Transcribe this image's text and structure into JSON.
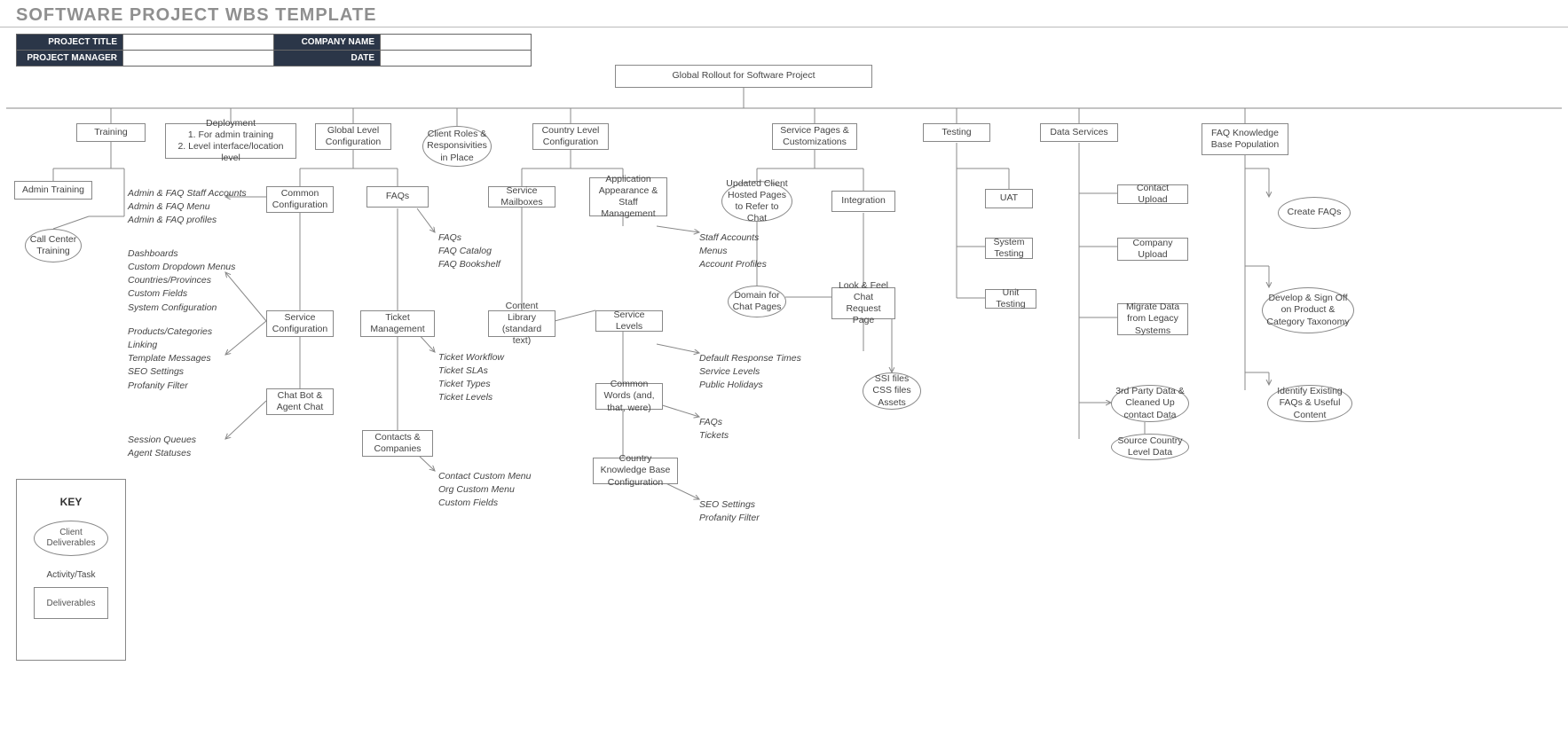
{
  "page_title": "SOFTWARE PROJECT WBS TEMPLATE",
  "meta": {
    "project_title_label": "PROJECT TITLE",
    "company_name_label": "COMPANY NAME",
    "project_manager_label": "PROJECT MANAGER",
    "date_label": "DATE",
    "project_title": "",
    "company_name": "",
    "project_manager": "",
    "date": ""
  },
  "root": "Global Rollout for Software Project",
  "columns": {
    "training": "Training",
    "deployment": "Deployment\n1. For admin training\n2. Level interface/location level",
    "global_config": "Global Level Configuration",
    "client_roles": "Client Roles & Responsivities in Place",
    "country_config": "Country Level Configuration",
    "service_pages": "Service Pages & Customizations",
    "testing": "Testing",
    "data_services": "Data Services",
    "faq_kb": "FAQ Knowledge Base Population"
  },
  "training": {
    "admin": "Admin Training",
    "call_center": "Call Center Training"
  },
  "deployment_notes": {
    "group1": [
      "Admin & FAQ Staff Accounts",
      "Admin & FAQ Menu",
      "Admin & FAQ profiles"
    ],
    "group2": [
      "Dashboards",
      "Custom Dropdown Menus",
      "Countries/Provinces",
      "Custom Fields",
      "System Configuration"
    ],
    "group3": [
      "Products/Categories",
      "Linking",
      "Template Messages",
      "SEO Settings",
      "Profanity Filter"
    ],
    "group4": [
      "Session Queues",
      "Agent Statuses"
    ]
  },
  "global_config_boxes": {
    "common_config": "Common Configuration",
    "service_config": "Service Configuration",
    "chatbot": "Chat Bot & Agent Chat",
    "faqs": "FAQs",
    "faqs_notes": [
      "FAQs",
      "FAQ Catalog",
      "FAQ Bookshelf"
    ],
    "ticket_mgmt": "Ticket Management",
    "ticket_notes": [
      "Ticket Workflow",
      "Ticket SLAs",
      "Ticket Types",
      "Ticket Levels"
    ],
    "contacts": "Contacts & Companies",
    "contacts_notes": [
      "Contact Custom Menu",
      "Org Custom Menu",
      "Custom Fields"
    ]
  },
  "country_config_boxes": {
    "service_mailboxes": "Service Mailboxes",
    "app_appearance": "Application Appearance & Staff Management",
    "app_notes": [
      "Staff Accounts",
      "Menus",
      "Account Profiles"
    ],
    "content_library": "Content Library (standard text)",
    "service_levels": "Service Levels",
    "service_levels_notes": [
      "Default Response Times",
      "Service Levels",
      "Public Holidays"
    ],
    "common_words": "Common Words (and, that, were)",
    "common_words_notes": [
      "FAQs",
      "Tickets"
    ],
    "country_kb": "Country Knowledge Base Configuration",
    "country_kb_notes": [
      "SEO Settings",
      "Profanity Filter"
    ]
  },
  "service_pages_boxes": {
    "updated_client": "Updated Client Hosted Pages to Refer to Chat",
    "domain_chat": "Domain for Chat Pages",
    "integration": "Integration",
    "look_feel": "Look & Feel Chat Request Page",
    "ssi": "SSI files\nCSS files\nAssets"
  },
  "testing_boxes": {
    "uat": "UAT",
    "system_testing": "System Testing",
    "unit_testing": "Unit Testing"
  },
  "data_services_boxes": {
    "contact_upload": "Contact Upload",
    "company_upload": "Company Upload",
    "migrate": "Migrate Data from Legacy Systems",
    "third_party": "3rd Party Data & Cleaned Up contact Data",
    "source_country": "Source Country Level Data"
  },
  "faq_kb_boxes": {
    "create_faqs": "Create FAQs",
    "develop_signoff": "Develop & Sign Off on Product & Category Taxonomy",
    "identify": "Identify Existing FAQs & Useful Content"
  },
  "key": {
    "title": "KEY",
    "client_deliverables": "Client Deliverables",
    "activity_task": "Activity/Task",
    "deliverables": "Deliverables"
  }
}
